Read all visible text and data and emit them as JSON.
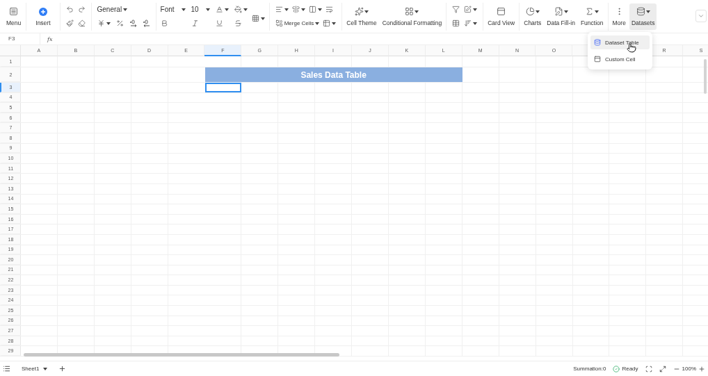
{
  "toolbar": {
    "menu": "Menu",
    "insert": "Insert",
    "number_format": "General",
    "font": "Font",
    "font_size": "10",
    "merge_cells": "Merge Cells",
    "button_groups": [
      [
        {
          "label": "Cell Theme",
          "dropdown": true,
          "selected": false
        },
        {
          "label": "Conditional Formatting",
          "dropdown": true,
          "selected": false
        }
      ],
      [
        {
          "label": "Card View",
          "dropdown": false,
          "selected": false
        }
      ],
      [
        {
          "label": "Charts",
          "dropdown": true,
          "selected": false
        },
        {
          "label": "Data Fill-in",
          "dropdown": true,
          "selected": false
        },
        {
          "label": "Function",
          "dropdown": true,
          "selected": false
        }
      ],
      [
        {
          "label": "More",
          "dropdown": false,
          "selected": false
        },
        {
          "label": "Datasets",
          "dropdown": true,
          "selected": true
        }
      ]
    ]
  },
  "formula_bar": {
    "cell_name": "F3",
    "fx": "fx"
  },
  "columns": [
    {
      "label": "A",
      "selected": false
    },
    {
      "label": "B",
      "selected": false
    },
    {
      "label": "C",
      "selected": false
    },
    {
      "label": "D",
      "selected": false
    },
    {
      "label": "E",
      "selected": false
    },
    {
      "label": "F",
      "selected": true
    },
    {
      "label": "G",
      "selected": false
    },
    {
      "label": "H",
      "selected": false
    },
    {
      "label": "I",
      "selected": false
    },
    {
      "label": "J",
      "selected": false
    },
    {
      "label": "K",
      "selected": false
    },
    {
      "label": "L",
      "selected": false
    },
    {
      "label": "M",
      "selected": false
    },
    {
      "label": "N",
      "selected": false
    },
    {
      "label": "O",
      "selected": false
    },
    {
      "selected": false
    },
    {},
    {
      "label": "R",
      "selected": false
    },
    {
      "label": "S",
      "selected": false
    }
  ],
  "rows": [
    {
      "label": "1",
      "selected": false
    },
    {
      "label": "2",
      "selected": false,
      "title": "Sales Data Table"
    },
    {
      "label": "3",
      "selected": true
    },
    {
      "label": "4",
      "selected": false
    },
    {
      "label": "5",
      "selected": false
    },
    {
      "label": "6",
      "selected": false
    },
    {
      "label": "7",
      "selected": false
    },
    {
      "label": "8",
      "selected": false
    },
    {
      "label": "9",
      "selected": false
    },
    {
      "label": "10",
      "selected": false
    },
    {
      "label": "11",
      "selected": false
    },
    {
      "label": "12",
      "selected": false
    },
    {
      "label": "13",
      "selected": false
    },
    {
      "label": "14",
      "selected": false
    },
    {
      "label": "15",
      "selected": false
    },
    {
      "label": "16",
      "selected": false
    },
    {
      "label": "17",
      "selected": false
    },
    {
      "label": "18",
      "selected": false
    },
    {
      "label": "19",
      "selected": false
    },
    {
      "label": "20",
      "selected": false
    },
    {
      "label": "21",
      "selected": false
    },
    {
      "label": "22",
      "selected": false
    },
    {
      "label": "23",
      "selected": false
    },
    {
      "label": "24",
      "selected": false
    },
    {
      "label": "25",
      "selected": false
    },
    {
      "label": "26",
      "selected": false
    },
    {
      "label": "27",
      "selected": false
    },
    {
      "label": "28",
      "selected": false
    },
    {
      "label": "29",
      "selected": false
    }
  ],
  "dropdown_menu": [
    {
      "label": "Dataset Table",
      "selected": true
    },
    {
      "label": "Custom Cell",
      "selected": false
    }
  ],
  "status_bar": {
    "sheet": "Sheet1",
    "summation": "Summation:0",
    "status": "Ready",
    "zoom": "100%"
  }
}
